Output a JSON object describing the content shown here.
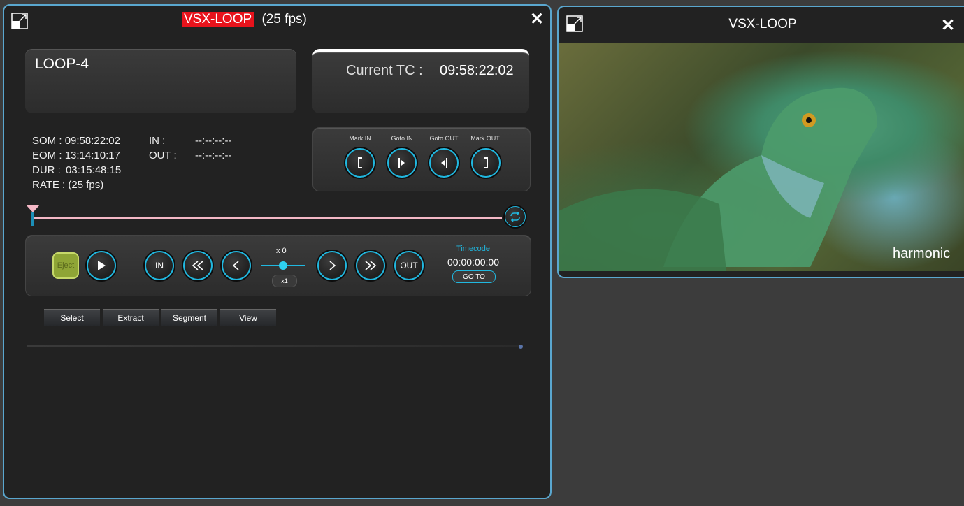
{
  "control_window": {
    "title_highlight": "VSX-LOOP",
    "title_suffix": "(25 fps)",
    "clip_name": "LOOP-4",
    "current_tc_label": "Current TC :",
    "current_tc_value": "09:58:22:02",
    "meta": {
      "som_label": "SOM :",
      "som_value": "09:58:22:02",
      "eom_label": "EOM :",
      "eom_value": "13:14:10:17",
      "dur_label": "DUR :",
      "dur_value": "03:15:48:15",
      "rate_label": "RATE :",
      "rate_value": "(25 fps)",
      "in_label": "IN :",
      "in_value": "--:--:--:--",
      "out_label": "OUT :",
      "out_value": "--:--:--:--"
    },
    "marks": {
      "mark_in": "Mark IN",
      "goto_in": "Goto IN",
      "goto_out": "Goto OUT",
      "mark_out": "Mark OUT"
    },
    "transport": {
      "eject": "Eject",
      "in": "IN",
      "out": "OUT",
      "speed_label": "x 0",
      "speed_reset": "x1",
      "timecode_label": "Timecode",
      "timecode_value": "00:00:00:00",
      "goto_label": "GO TO"
    },
    "tabs": [
      "Select",
      "Extract",
      "Segment",
      "View"
    ],
    "playhead_position": 0.0
  },
  "viewer_window": {
    "title": "VSX-LOOP",
    "watermark": "harmonic"
  },
  "colors": {
    "accent": "#20b8e0",
    "title_highlight": "#e8131c",
    "eject_green": "#8fa536",
    "timeline_pink": "#f4b8c6",
    "panel_border": "#5aa7cf"
  }
}
